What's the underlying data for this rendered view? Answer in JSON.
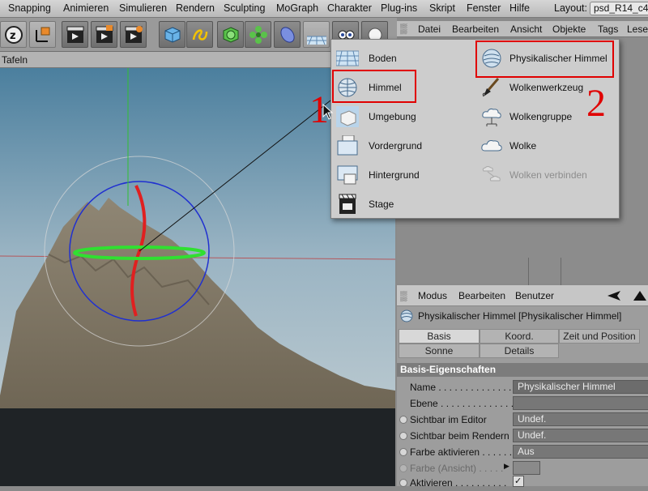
{
  "menubar": {
    "items": [
      "Snapping",
      "Animieren",
      "Simulieren",
      "Rendern",
      "Sculpting",
      "MoGraph",
      "Charakter",
      "Plug-ins",
      "Skript",
      "Fenster",
      "Hilfe"
    ],
    "layout_label": "Layout:",
    "layout_value": "psd_R14_c4"
  },
  "toolbar": {
    "icons": [
      "undo-icon",
      "axis-icon",
      "render-view-icon",
      "render-picture-icon",
      "render-settings-icon",
      "cube-icon",
      "spline-icon",
      "nurbs-icon",
      "array-icon",
      "deformer-icon",
      "floor-icon",
      "camera-icon",
      "light-icon"
    ]
  },
  "viewport": {
    "header_label": "Tafeln"
  },
  "object_manager": {
    "menu": [
      "Datei",
      "Bearbeiten",
      "Ansicht",
      "Objekte",
      "Tags",
      "Lese"
    ]
  },
  "dropdown": {
    "left": [
      {
        "label": "Boden",
        "icon": "floor-icon"
      },
      {
        "label": "Himmel",
        "icon": "sky-icon"
      },
      {
        "label": "Umgebung",
        "icon": "environment-icon"
      },
      {
        "label": "Vordergrund",
        "icon": "foreground-icon"
      },
      {
        "label": "Hintergrund",
        "icon": "background-icon"
      },
      {
        "label": "Stage",
        "icon": "stage-icon"
      }
    ],
    "right": [
      {
        "label": "Physikalischer Himmel",
        "icon": "physical-sky-icon"
      },
      {
        "label": "Wolkenwerkzeug",
        "icon": "cloud-tool-icon"
      },
      {
        "label": "Wolkengruppe",
        "icon": "cloud-group-icon"
      },
      {
        "label": "Wolke",
        "icon": "cloud-icon"
      },
      {
        "label": "Wolken verbinden",
        "icon": "connect-clouds-icon"
      }
    ]
  },
  "annotations": {
    "one": "1",
    "two": "2",
    "highlight_color": "#e00000"
  },
  "attributes": {
    "menu": [
      "Modus",
      "Bearbeiten",
      "Benutzer"
    ],
    "title": "Physikalischer Himmel [Physikalischer Himmel]",
    "tabs_row1": [
      "Basis",
      "Koord.",
      "Zeit und Position"
    ],
    "tabs_row2": [
      "Sonne",
      "Details"
    ],
    "section": "Basis-Eigenschaften",
    "rows": [
      {
        "label": "Name . . . . . . . . . . . . . .",
        "value": "Physikalischer Himmel"
      },
      {
        "label": "Ebene . . . . . . . . . . . . . .",
        "value": ""
      },
      {
        "label": "Sichtbar im Editor",
        "value": "Undef."
      },
      {
        "label": "Sichtbar beim Rendern",
        "value": "Undef."
      },
      {
        "label": "Farbe aktivieren . . . . . .",
        "value": "Aus"
      },
      {
        "label": "Farbe (Ansicht) . . . . .",
        "value": ""
      },
      {
        "label": "Aktivieren . . . . . . . . . .",
        "value": "✓"
      }
    ]
  }
}
